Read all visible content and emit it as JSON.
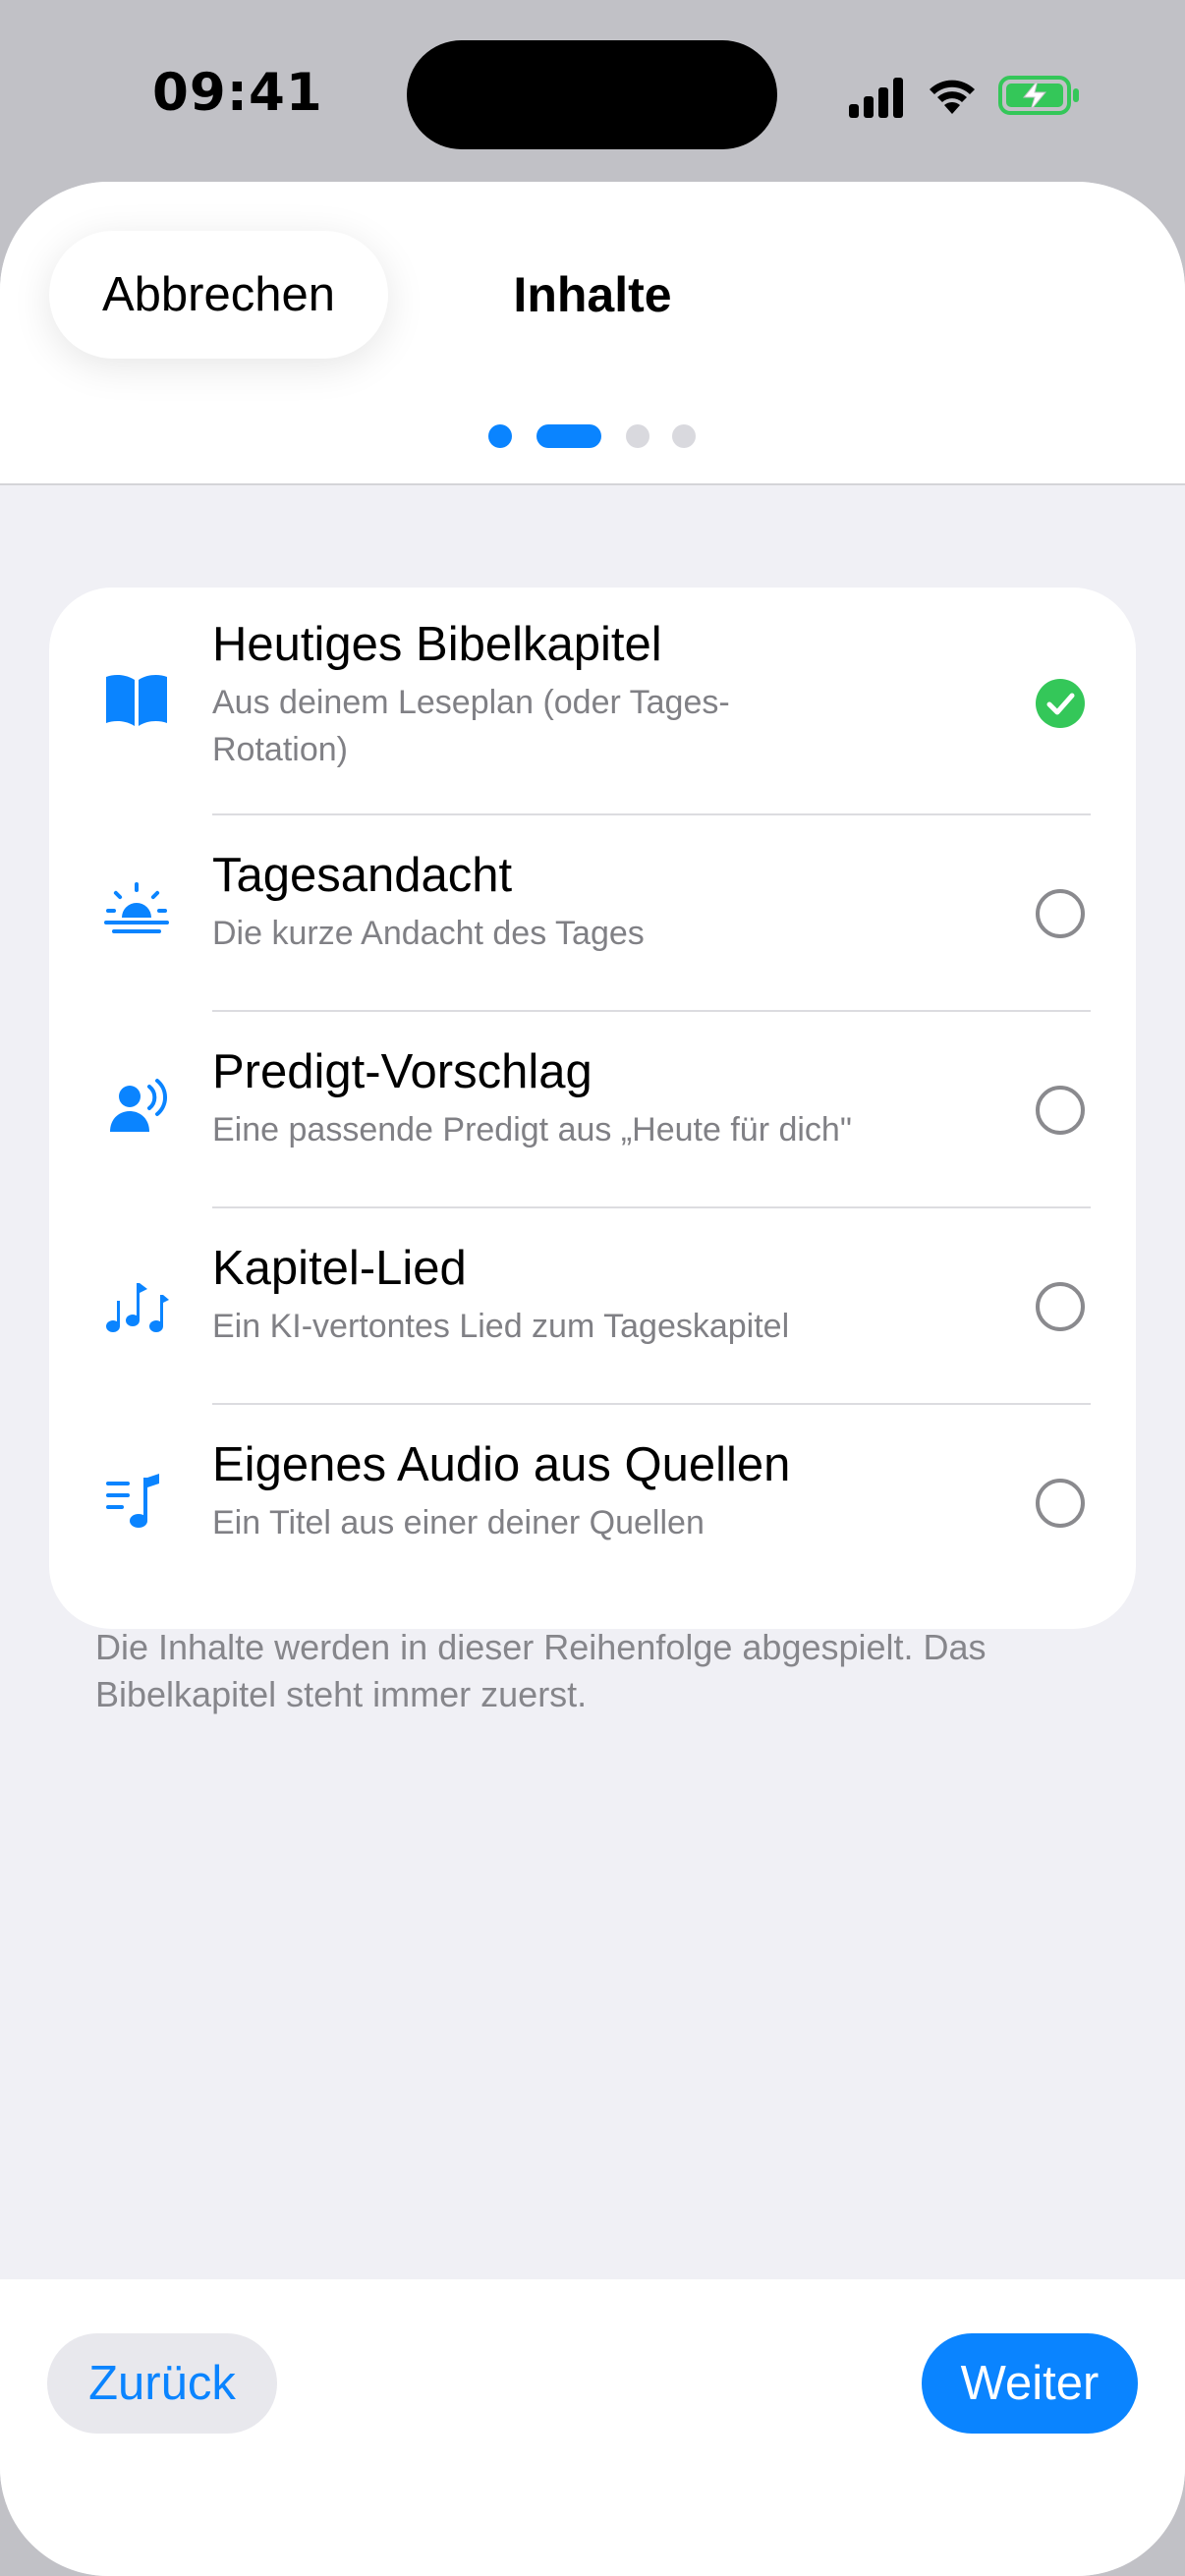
{
  "status_bar": {
    "time": "09:41",
    "icons": [
      "cellular-signal-icon",
      "wifi-icon",
      "battery-charging-icon"
    ]
  },
  "header": {
    "cancel_label": "Abbrechen",
    "title": "Inhalte",
    "page_indicator": {
      "current": 2,
      "total": 4
    }
  },
  "items": [
    {
      "icon": "book-icon",
      "title": "Heutiges Bibelkapitel",
      "subtitle": "Aus deinem Leseplan (oder Tages-Rotation)",
      "selected": true
    },
    {
      "icon": "sunrise-icon",
      "title": "Tagesandacht",
      "subtitle": "Die kurze Andacht des Tages",
      "selected": false
    },
    {
      "icon": "person-speaking-icon",
      "title": "Predigt-Vorschlag",
      "subtitle": "Eine passende Predigt aus „Heute für dich\"",
      "selected": false
    },
    {
      "icon": "music-notes-icon",
      "title": "Kapitel-Lied",
      "subtitle": "Ein KI-vertontes Lied zum Tageskapitel",
      "selected": false
    },
    {
      "icon": "music-list-icon",
      "title": "Eigenes Audio aus Quellen",
      "subtitle": "Ein Titel aus einer deiner Quellen",
      "selected": false
    }
  ],
  "footer_note": "Die Inhalte werden in dieser Reihenfolge abgespielt. Das Bibelkapitel steht immer zuerst.",
  "bottom": {
    "back_label": "Zurück",
    "next_label": "Weiter"
  },
  "colors": {
    "accent": "#0a84ff",
    "checked": "#34c759",
    "inactive_dot": "#d9d9de",
    "background": "#f0f0f5"
  }
}
